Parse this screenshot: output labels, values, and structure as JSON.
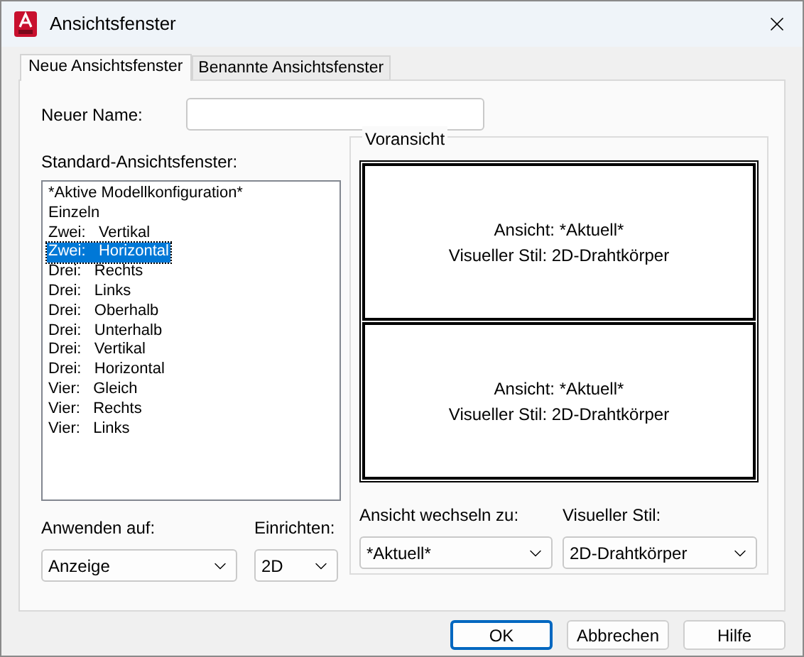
{
  "window": {
    "title": "Ansichtsfenster"
  },
  "tabs": [
    {
      "label": "Neue Ansichtsfenster",
      "selected": true
    },
    {
      "label": "Benannte Ansichtsfenster",
      "selected": false
    }
  ],
  "new_name": {
    "label": "Neuer Name:"
  },
  "standard_viewports": {
    "label": "Standard-Ansichtsfenster:",
    "items": [
      {
        "label": "*Aktive Modellkonfiguration*",
        "selected": false
      },
      {
        "label": "Einzeln",
        "selected": false
      },
      {
        "label": "Zwei:   Vertikal",
        "selected": false
      },
      {
        "label": "Zwei:   Horizontal",
        "selected": true
      },
      {
        "label": "Drei:   Rechts",
        "selected": false
      },
      {
        "label": "Drei:   Links",
        "selected": false
      },
      {
        "label": "Drei:   Oberhalb",
        "selected": false
      },
      {
        "label": "Drei:   Unterhalb",
        "selected": false
      },
      {
        "label": "Drei:   Vertikal",
        "selected": false
      },
      {
        "label": "Drei:   Horizontal",
        "selected": false
      },
      {
        "label": "Vier:   Gleich",
        "selected": false
      },
      {
        "label": "Vier:   Rechts",
        "selected": false
      },
      {
        "label": "Vier:   Links",
        "selected": false
      }
    ]
  },
  "preview": {
    "title": "Voransicht",
    "panes": [
      {
        "view": "Ansicht: *Aktuell*",
        "style": "Visueller Stil: 2D-Drahtkörper"
      },
      {
        "view": "Ansicht: *Aktuell*",
        "style": "Visueller Stil: 2D-Drahtkörper"
      }
    ]
  },
  "apply_to": {
    "label": "Anwenden auf:",
    "value": "Anzeige"
  },
  "setup": {
    "label": "Einrichten:",
    "value": "2D"
  },
  "change_view": {
    "label": "Ansicht wechseln zu:",
    "value": "*Aktuell*"
  },
  "visual_style": {
    "label": "Visueller Stil:",
    "value": "2D-Drahtkörper"
  },
  "buttons": [
    {
      "label": "OK",
      "default": true
    },
    {
      "label": "Abbrechen",
      "default": false
    },
    {
      "label": "Hilfe",
      "default": false
    }
  ]
}
